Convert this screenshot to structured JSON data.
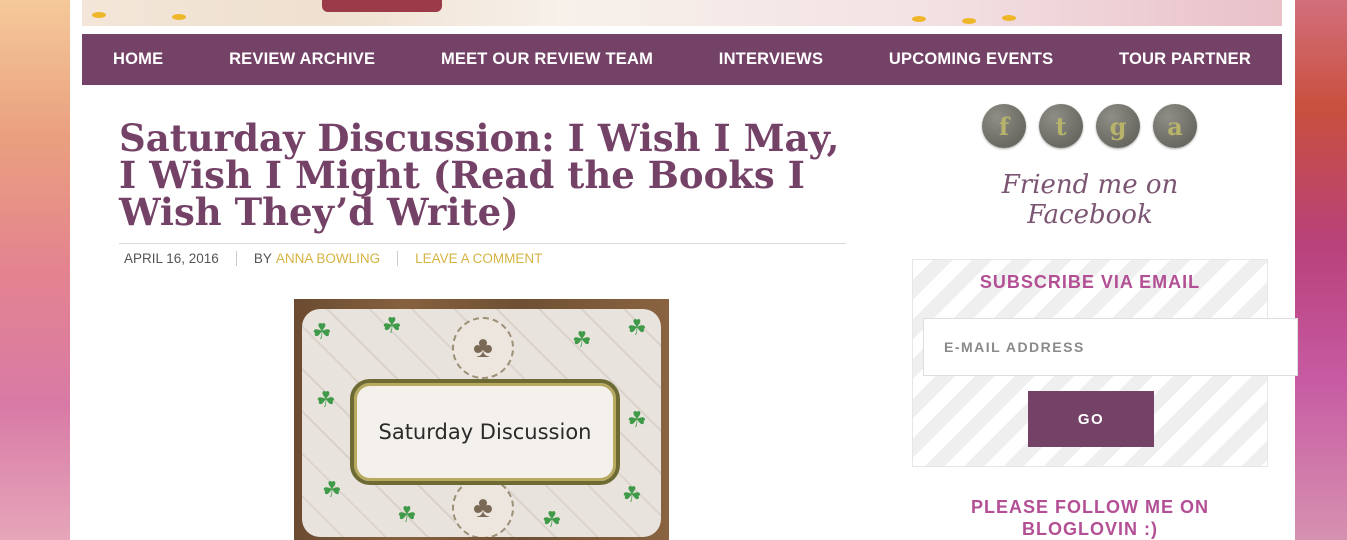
{
  "nav": {
    "items": [
      "HOME",
      "REVIEW ARCHIVE",
      "MEET OUR REVIEW TEAM",
      "INTERVIEWS",
      "UPCOMING EVENTS",
      "TOUR PARTNER"
    ]
  },
  "post": {
    "title": "Saturday Discussion: I Wish I May, I Wish I Might (Read the Books I Wish They’d Write)",
    "date": "APRIL 16, 2016",
    "by_label": "BY",
    "author": "ANNA BOWLING",
    "comment_link": "LEAVE A COMMENT",
    "image_text": "Saturday Discussion"
  },
  "sidebar": {
    "social_icons": [
      {
        "name": "facebook-icon",
        "glyph": "f"
      },
      {
        "name": "twitter-icon",
        "glyph": "t"
      },
      {
        "name": "goodreads-icon",
        "glyph": "g"
      },
      {
        "name": "amazon-icon",
        "glyph": "a"
      }
    ],
    "friend_text": "Friend me on Facebook",
    "subscribe": {
      "title": "SUBSCRIBE VIA EMAIL",
      "placeholder": "E-MAIL ADDRESS",
      "button": "GO"
    },
    "bloglovin": "PLEASE FOLLOW ME ON BLOGLOVIN :)"
  },
  "colors": {
    "nav_bg": "#754267",
    "title": "#754267",
    "accent_gold": "#d6b443",
    "sidebar_heading": "#b34f95"
  }
}
